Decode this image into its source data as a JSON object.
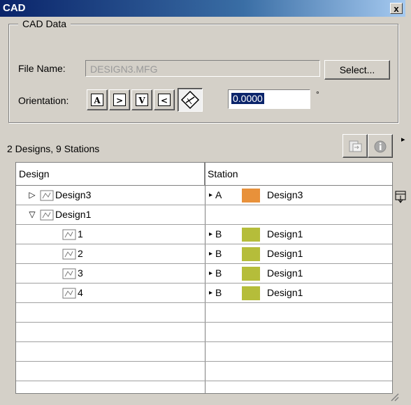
{
  "window": {
    "title": "CAD",
    "close_glyph": "x"
  },
  "cad_data": {
    "legend": "CAD Data",
    "file_name_label": "File Name:",
    "file_name_value": "DESIGN3.MFG",
    "select_label": "Select...",
    "orientation_label": "Orientation:",
    "orientation_buttons": [
      {
        "glyph": "A",
        "icon": "orientation-a-icon"
      },
      {
        "glyph": ">",
        "icon": "orientation-right-icon"
      },
      {
        "glyph": "V",
        "icon": "orientation-v-icon"
      },
      {
        "glyph": "<",
        "icon": "orientation-left-icon"
      },
      {
        "glyph": "⟡",
        "icon": "orientation-free-icon"
      }
    ],
    "angle_value": "0.0000",
    "angle_unit": "°"
  },
  "summary": "2 Designs, 9 Stations",
  "table": {
    "headers": {
      "design": "Design",
      "station": "Station"
    },
    "rows": [
      {
        "expander": "▷",
        "name": "Design3",
        "station_arrow": "▸",
        "station": "A",
        "station_design": "Design3",
        "color": "#e8913a"
      },
      {
        "expander": "▽",
        "name": "Design1",
        "station_arrow": "",
        "station": "",
        "station_design": "",
        "color": ""
      },
      {
        "expander": "",
        "name": "1",
        "station_arrow": "▸",
        "station": "B",
        "station_design": "Design1",
        "color": "#b5bd3a"
      },
      {
        "expander": "",
        "name": "2",
        "station_arrow": "▸",
        "station": "B",
        "station_design": "Design1",
        "color": "#b5bd3a"
      },
      {
        "expander": "",
        "name": "3",
        "station_arrow": "▸",
        "station": "B",
        "station_design": "Design1",
        "color": "#b5bd3a"
      },
      {
        "expander": "",
        "name": "4",
        "station_arrow": "▸",
        "station": "B",
        "station_design": "Design1",
        "color": "#b5bd3a"
      }
    ],
    "empty_rows": 4
  }
}
